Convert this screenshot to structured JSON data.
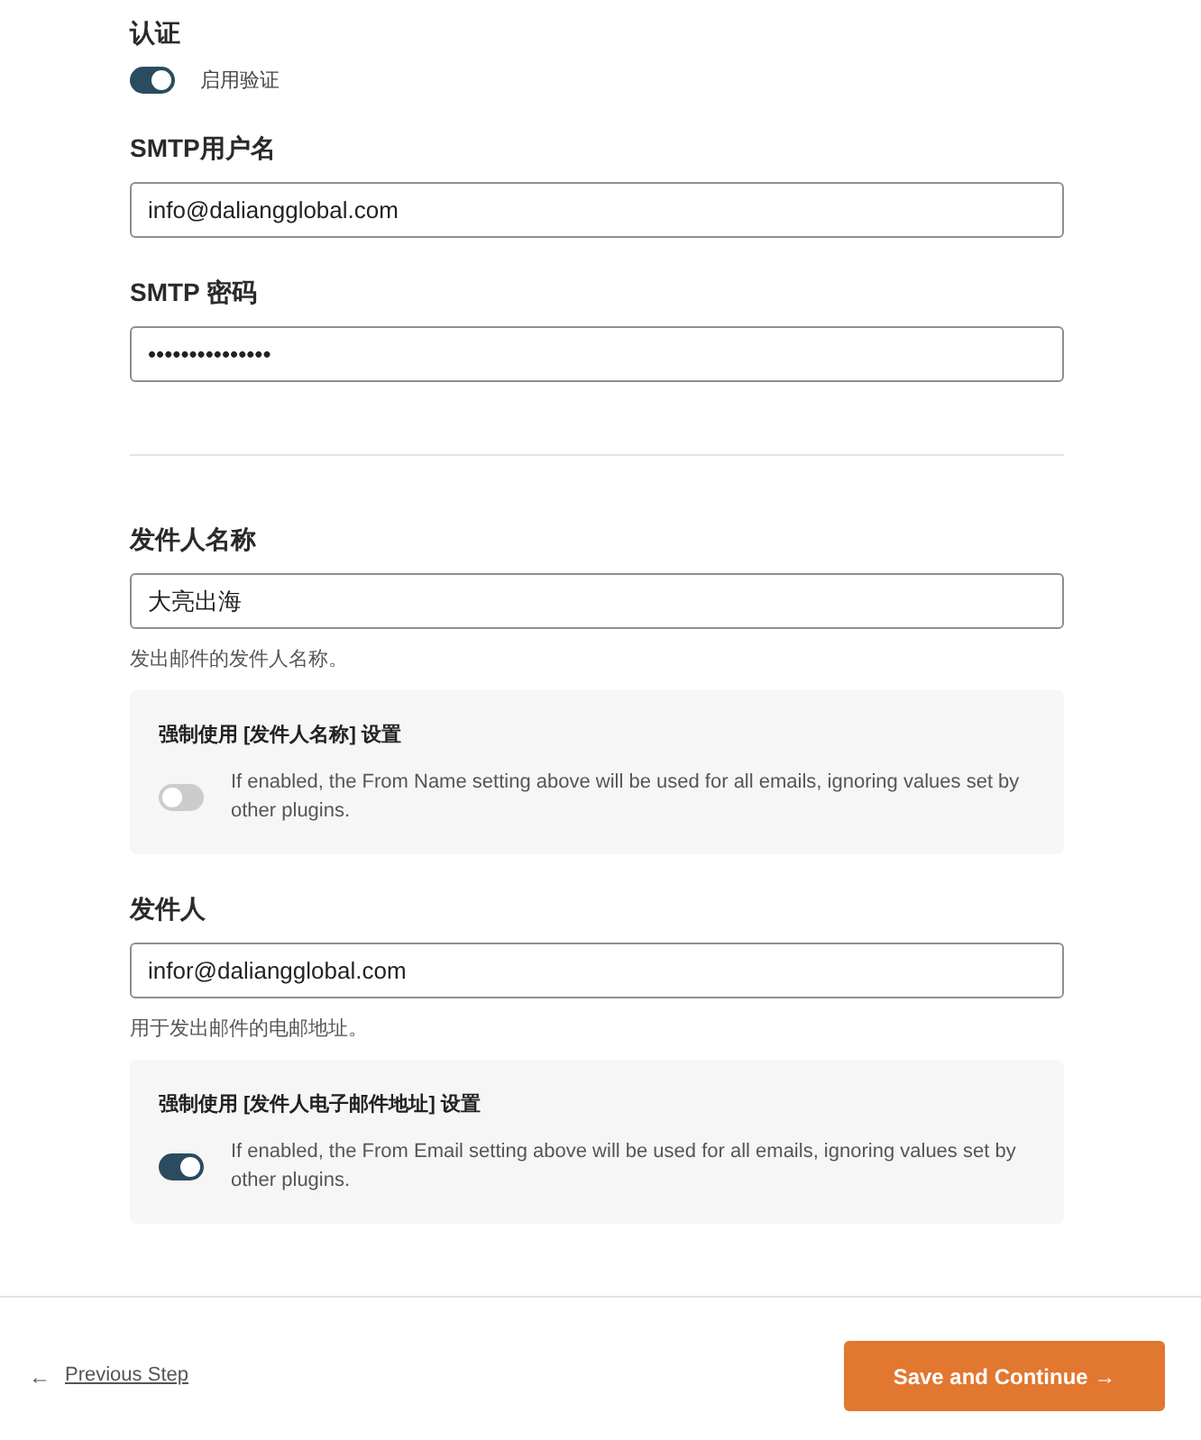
{
  "groups": [
    {
      "fields": [
        {
          "kind": "switch",
          "label": "认证",
          "switch_label": "启用验证",
          "on": true
        },
        {
          "kind": "text",
          "label": "SMTP用户名",
          "value": "info@daliangglobal.com"
        },
        {
          "kind": "text",
          "label": "SMTP 密码",
          "value": "•••••••••••••••"
        }
      ]
    },
    {
      "fields": [
        {
          "kind": "text",
          "label": "发件人名称",
          "value": "大亮出海",
          "help": "发出邮件的发件人名称。",
          "option": {
            "title": "强制使用 [发件人名称] 设置",
            "description": "If enabled, the From Name setting above will be used for all emails, ignoring values set by other plugins.",
            "on": false
          }
        },
        {
          "kind": "text",
          "label": "发件人",
          "value": "infor@daliangglobal.com",
          "help": "用于发出邮件的电邮地址。",
          "option": {
            "title": "强制使用 [发件人电子邮件地址] 设置",
            "description": "If enabled, the From Email setting above will be used for all emails, ignoring values set by other plugins.",
            "on": true
          }
        }
      ]
    }
  ],
  "footer": {
    "back": {
      "arrow": "←",
      "label": "Previous Step"
    },
    "next": {
      "label": "Save and Continue",
      "arrow": "→"
    }
  }
}
